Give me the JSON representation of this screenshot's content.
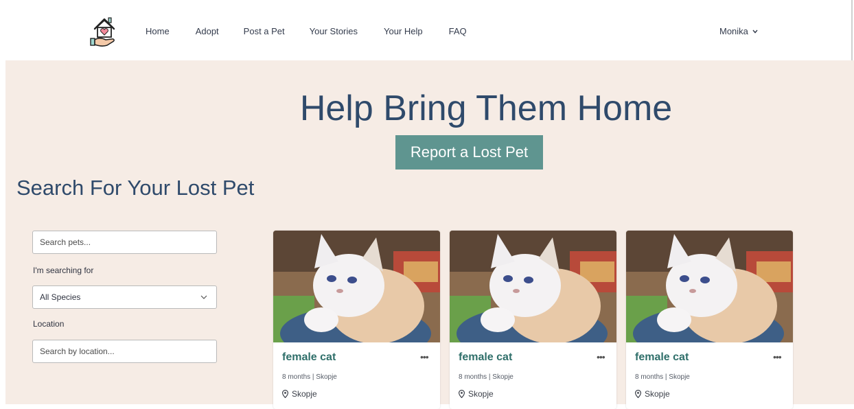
{
  "nav": {
    "links": [
      "Home",
      "Adopt",
      "Post a Pet",
      "Your Stories",
      "Your Help",
      "FAQ"
    ],
    "user_name": "Monika",
    "logo_icon": "house-in-hand-icon"
  },
  "hero": {
    "title": "Help Bring Them Home",
    "report_button": "Report a Lost Pet"
  },
  "search": {
    "heading": "Search For Your Lost Pet",
    "search_placeholder": "Search pets...",
    "species_label": "I'm searching for",
    "species_selected": "All Species",
    "location_label": "Location",
    "location_placeholder": "Search by location..."
  },
  "cards": [
    {
      "title": "female cat",
      "meta": "8 months | Skopje",
      "location": "Skopje"
    },
    {
      "title": "female cat",
      "meta": "8 months | Skopje",
      "location": "Skopje"
    },
    {
      "title": "female cat",
      "meta": "8 months | Skopje",
      "location": "Skopje"
    }
  ],
  "colors": {
    "primary_text": "#2f4a6b",
    "accent_button": "#5f9590",
    "card_title": "#2f6f6a",
    "background": "#f6ece5"
  }
}
